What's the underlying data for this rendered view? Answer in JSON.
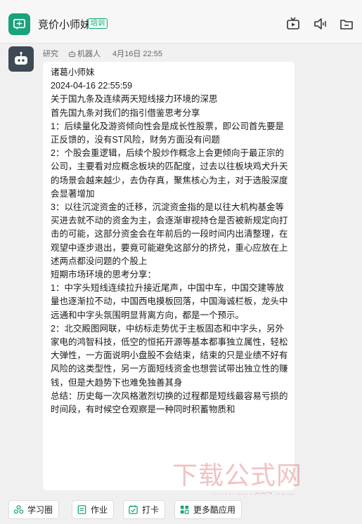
{
  "header": {
    "title": "竞价小师妹",
    "tag": "培训"
  },
  "message": {
    "sender_name": "研究",
    "robot_label": "机器人",
    "time": "4月16日 22:55",
    "lines": [
      "诸葛小师妹",
      "2024-04-16 22:55:59",
      "关于国九条及连续两天短线接力环境的深思",
      "首先国九条对我们的指引借鉴思考分享",
      "1：后续量化及游资倾向性会是成长性股票，即公司首先要是正反馈的，没有ST风险，财务方面没有问题",
      "2：个股会重逻辑，后续个股炒作概念上会更倾向于最正宗的公司，主要看对应概念板块的匹配度，过去以往板块鸡犬升天的场景会越来越少，去伪存真，聚焦核心为主，对于选股深度会显著增加",
      "3：以往沉淀资金的迁移，沉淀资金指的是以往大机构基金等买进去就不动的资金为主，会逐渐审视持仓是否被新规定向打击的可能，这部分资金会在年前后的一段时间内出清整理，在观望中逐步退出，要竟可能避免这部分的挤兑，重心应放在上述两点都没问题的个股上",
      "短期市场环境的思考分享：",
      "1：中字头短线连续拉升接近尾声，中国中车，中国交建等放量也逐渐拉不动，中国西电摸板回落，中国海诚栏板，龙头中远通和中字头氛围明显背离方向，都是一个预示。",
      "2：北交殿图网联，中纺标走势优于主板固态和中字头，另外家电的鸿智科技，低空的恒拓开源等基本都事独立属性，轻松大弹性，一方面说明小盘股不会结束，结束的只是业绩不好有风险的这类型性，另一方面短线资金也想尝试带出独立性的赚钱，但是大趋势下也难免独善其身",
      "总结：历史每一次风格激烈切换的过程都是短线最容易亏损的时间段，有时候空仓观察是一种同时积蓄物质和"
    ]
  },
  "watermark": {
    "text": "下载公式网",
    "url": "www.gsw007.com"
  },
  "toolbar": {
    "buttons": [
      {
        "label": "学习圈",
        "icon": "study-circle-icon"
      },
      {
        "label": "作业",
        "icon": "homework-icon"
      },
      {
        "label": "打卡",
        "icon": "checkin-icon"
      },
      {
        "label": "更多酷应用",
        "icon": "more-apps-icon"
      }
    ]
  },
  "colors": {
    "accent": "#1aa37a",
    "avatar_bg": "#3d4a55"
  }
}
